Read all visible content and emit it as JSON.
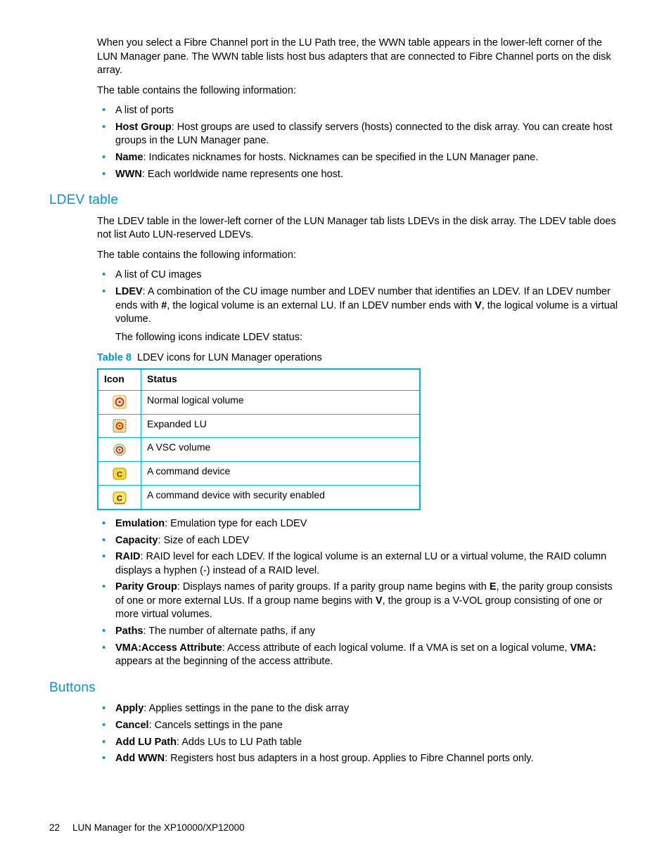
{
  "intro": {
    "p1": "When you select a Fibre Channel port in the LU Path tree, the WWN table appears in the lower-left corner of the LUN Manager pane. The WWN table lists host bus adapters that are connected to Fibre Channel ports on the disk array.",
    "p2": "The table contains the following information:"
  },
  "wwn_items": {
    "i0": "A list of ports",
    "i1_label": "Host Group",
    "i1_rest": ": Host groups are used to classify servers (hosts) connected to the disk array. You can create host groups in the LUN Manager pane.",
    "i2_label": "Name",
    "i2_rest": ": Indicates nicknames for hosts. Nicknames can be specified in the LUN Manager pane.",
    "i3_label": "WWN",
    "i3_rest": ": Each worldwide name represents one host."
  },
  "ldev": {
    "heading": "LDEV table",
    "p1": "The LDEV table in the lower-left corner of the LUN Manager tab lists LDEVs in the disk array. The LDEV table does not list Auto LUN-reserved LDEVs.",
    "p2": "The table contains the following information:",
    "li0": "A list of CU images",
    "li1_label": "LDEV",
    "li1_rest_a": ": A combination of the CU image number and LDEV number that identifies an LDEV. If an LDEV number ends with ",
    "li1_hash": "#",
    "li1_rest_b": ", the logical volume is an external LU. If an LDEV number ends with ",
    "li1_v": "V",
    "li1_rest_c": ", the logical volume is a virtual volume.",
    "li1_sub": "The following icons indicate LDEV status:"
  },
  "table8": {
    "label": "Table 8",
    "caption_rest": "LDEV icons for LUN Manager operations",
    "h_icon": "Icon",
    "h_status": "Status",
    "rows": {
      "r0": "Normal logical volume",
      "r1": "Expanded LU",
      "r2": "A VSC volume",
      "r3": "A command device",
      "r4": "A command device with security enabled"
    }
  },
  "post_items": {
    "i0_label": "Emulation",
    "i0_rest": ": Emulation type for each LDEV",
    "i1_label": "Capacity",
    "i1_rest": ": Size of each LDEV",
    "i2_label": "RAID",
    "i2_rest": ": RAID level for each LDEV. If the logical volume is an external LU or a virtual volume, the RAID column displays a hyphen (-) instead of a RAID level.",
    "i3_label": "Parity Group",
    "i3_rest_a": ": Displays names of parity groups. If a parity group name begins with ",
    "i3_e": "E",
    "i3_rest_b": ", the parity group consists of one or more external LUs. If a group name begins with ",
    "i3_v": "V",
    "i3_rest_c": ", the group is a V-VOL group consisting of one or more virtual volumes.",
    "i4_label": "Paths",
    "i4_rest": ": The number of alternate paths, if any",
    "i5_label": "VMA:Access Attribute",
    "i5_rest_a": ": Access attribute of each logical volume. If a VMA is set on a logical volume, ",
    "i5_vma": "VMA:",
    "i5_rest_b": " appears at the beginning of the access attribute."
  },
  "buttons": {
    "heading": "Buttons",
    "i0_label": "Apply",
    "i0_rest": ": Applies settings in the pane to the disk array",
    "i1_label": "Cancel",
    "i1_rest": ": Cancels settings in the pane",
    "i2_label": "Add LU Path",
    "i2_rest": ": Adds LUs to LU Path table",
    "i3_label": "Add WWN",
    "i3_rest": ": Registers host bus adapters in a host group. Applies to Fibre Channel ports only."
  },
  "footer": {
    "pagenum": "22",
    "title": "LUN Manager for the XP10000/XP12000"
  }
}
